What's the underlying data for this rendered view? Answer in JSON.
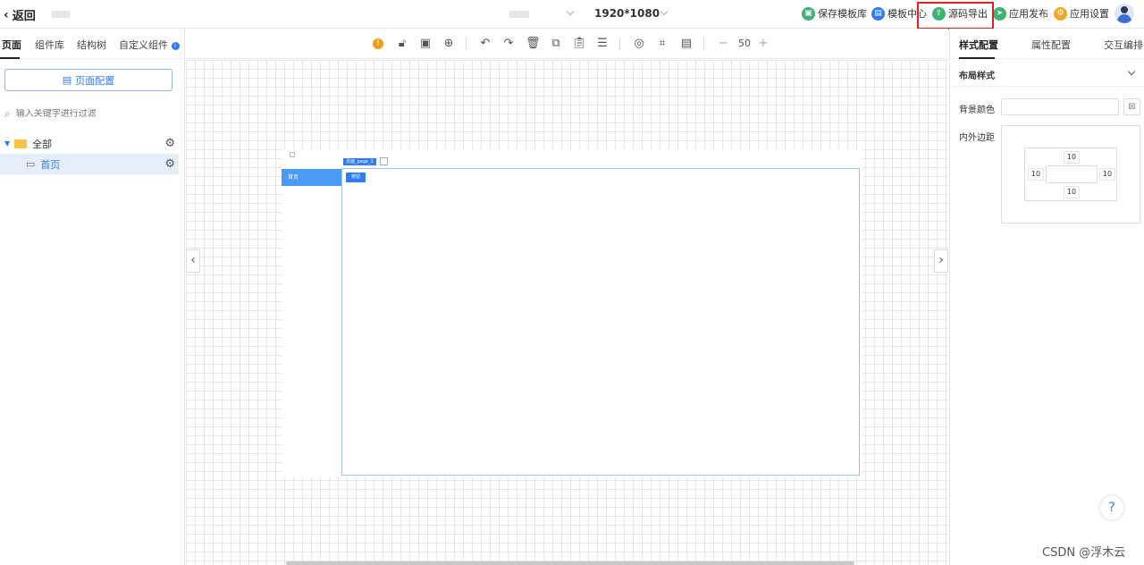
{
  "header": {
    "back_label": "返回",
    "resolution": "1920*1080",
    "actions": [
      {
        "label": "保存模板库",
        "icon": "save-icon",
        "color": "#3cb371"
      },
      {
        "label": "模板中心",
        "icon": "template-icon",
        "color": "#2f7bf5"
      },
      {
        "label": "源码导出",
        "icon": "export-icon",
        "color": "#3cb371"
      },
      {
        "label": "应用发布",
        "icon": "publish-icon",
        "color": "#3cb371"
      },
      {
        "label": "应用设置",
        "icon": "settings-icon",
        "color": "#f5a623"
      }
    ]
  },
  "left": {
    "tabs": [
      "页面",
      "组件库",
      "结构树",
      "自定义组件"
    ],
    "page_config_label": "页面配置",
    "filter_placeholder": "输入关键字进行过滤",
    "tree": [
      {
        "label": "全部",
        "icon": "folder-icon"
      },
      {
        "label": "首页",
        "icon": "page-icon"
      }
    ]
  },
  "toolbar": {
    "zoom": "50"
  },
  "canvas": {
    "menu_item": "首页",
    "button_label": "按钮",
    "page_tag": "页面_page_1"
  },
  "right": {
    "tabs": [
      "样式配置",
      "属性配置",
      "交互编排"
    ],
    "section_title": "布局样式",
    "bg_color_label": "背景颜色",
    "spacing_label": "内外边距",
    "spacing": {
      "top": "10",
      "left": "10",
      "right": "10",
      "bottom": "10"
    }
  },
  "watermark": "CSDN @浮木云"
}
